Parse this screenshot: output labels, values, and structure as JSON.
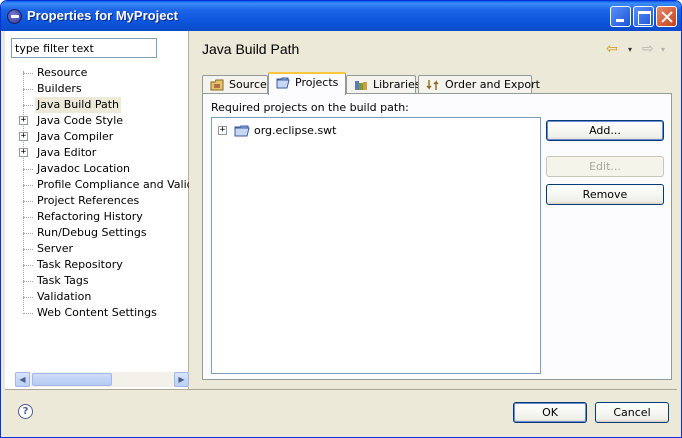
{
  "window": {
    "title": "Properties for MyProject"
  },
  "filter": {
    "value": "type filter text"
  },
  "tree": {
    "items": [
      {
        "label": "Resource",
        "expandable": false,
        "selected": false
      },
      {
        "label": "Builders",
        "expandable": false,
        "selected": false
      },
      {
        "label": "Java Build Path",
        "expandable": false,
        "selected": true
      },
      {
        "label": "Java Code Style",
        "expandable": true,
        "selected": false
      },
      {
        "label": "Java Compiler",
        "expandable": true,
        "selected": false
      },
      {
        "label": "Java Editor",
        "expandable": true,
        "selected": false
      },
      {
        "label": "Javadoc Location",
        "expandable": false,
        "selected": false
      },
      {
        "label": "Profile Compliance and Validation",
        "expandable": false,
        "selected": false
      },
      {
        "label": "Project References",
        "expandable": false,
        "selected": false
      },
      {
        "label": "Refactoring History",
        "expandable": false,
        "selected": false
      },
      {
        "label": "Run/Debug Settings",
        "expandable": false,
        "selected": false
      },
      {
        "label": "Server",
        "expandable": false,
        "selected": false
      },
      {
        "label": "Task Repository",
        "expandable": false,
        "selected": false
      },
      {
        "label": "Task Tags",
        "expandable": false,
        "selected": false
      },
      {
        "label": "Validation",
        "expandable": false,
        "selected": false
      },
      {
        "label": "Web Content Settings",
        "expandable": false,
        "selected": false
      }
    ]
  },
  "page": {
    "title": "Java Build Path"
  },
  "tabs": [
    {
      "label": "Source",
      "active": false
    },
    {
      "label": "Projects",
      "active": true
    },
    {
      "label": "Libraries",
      "active": false
    },
    {
      "label": "Order and Export",
      "active": false
    }
  ],
  "projects": {
    "label": "Required projects on the build path:",
    "items": [
      {
        "label": "org.eclipse.swt"
      }
    ]
  },
  "actions": {
    "add": "Add...",
    "edit": "Edit...",
    "remove": "Remove"
  },
  "footer": {
    "ok": "OK",
    "cancel": "Cancel",
    "help": "?"
  },
  "icons": {
    "expander": "+",
    "nav_back": "⇦",
    "nav_forward": "⇨",
    "dropdown": "▾",
    "scroll_left": "◀",
    "scroll_right": "▶"
  }
}
